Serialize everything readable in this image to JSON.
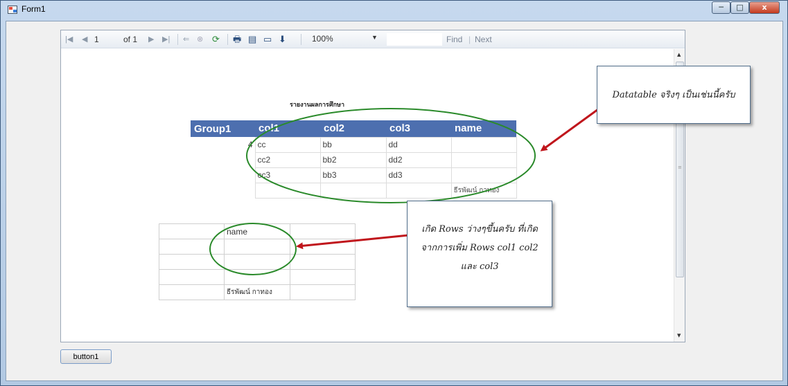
{
  "window": {
    "title": "Form1",
    "minimize_label": "─",
    "maximize_label": "□",
    "close_label": "x"
  },
  "toolbar": {
    "first_icon": "|◀",
    "prev_icon": "◀",
    "page_value": "1",
    "page_of": "of 1",
    "next_icon": "▶",
    "last_icon": "▶|",
    "back_icon": "⇐",
    "stop_icon": "⊗",
    "refresh_icon": "⟳",
    "print_icon": "🖶",
    "layout_icon": "▤",
    "setup_icon": "▭",
    "export_icon": "⬇",
    "zoom": "100%",
    "zoom_arrow": "▼",
    "find_label": "Find",
    "find_sep": "|",
    "next_label": "Next"
  },
  "report": {
    "title": "รายงานผลการศึกษา",
    "table1": {
      "headers": [
        "Group1",
        "col1",
        "col2",
        "col3",
        "name"
      ],
      "group_value": "4",
      "rows": [
        [
          "cc",
          "bb",
          "dd",
          ""
        ],
        [
          "cc2",
          "bb2",
          "dd2",
          ""
        ],
        [
          "cc3",
          "bb3",
          "dd3",
          ""
        ]
      ],
      "footer_name": "ธีรพัฒน์ กาทอง"
    },
    "table2": {
      "header": "name",
      "footer_name": "ธีรพัฒน์ กาทอง"
    }
  },
  "callouts": {
    "first": "Datatable จริงๆ เป็นเช่นนี้ครับ",
    "second_line1": "เกิด Rows ว่างๆขึ้นครับ ที่เกิด",
    "second_line2": "จากการเพิ่ม Rows col1 col2",
    "second_line3": "และ col3"
  },
  "scrollbar": {
    "up_arrow": "▲",
    "down_arrow": "▼",
    "grip": "≡"
  },
  "button1": {
    "label": "button1"
  },
  "colors": {
    "header_blue": "#4d6faf",
    "ellipse_green": "#2a8a2a",
    "arrow_red": "#c0161c"
  }
}
